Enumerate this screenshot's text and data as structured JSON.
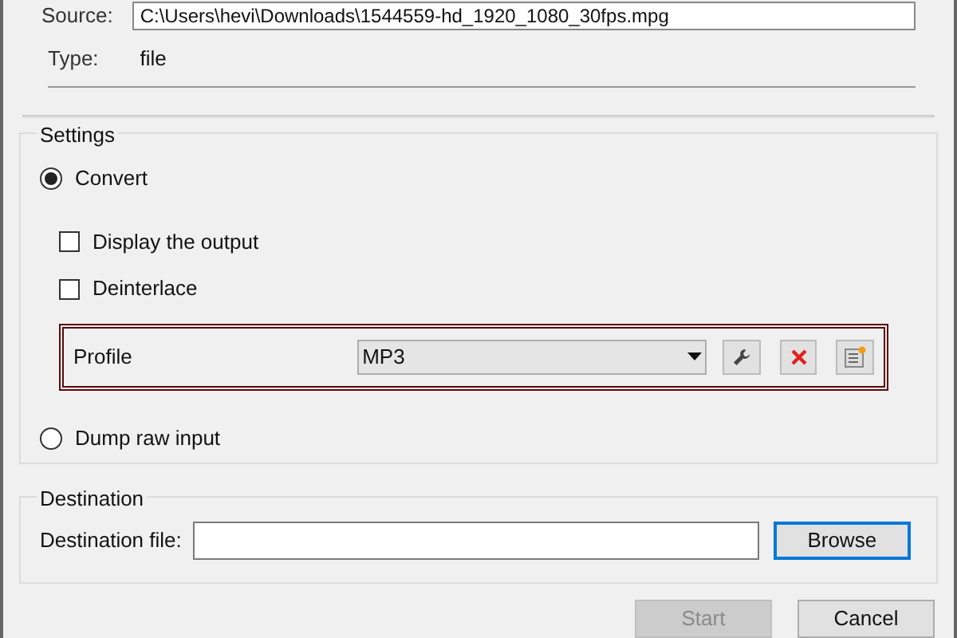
{
  "source": {
    "label": "Source:",
    "value": "C:\\Users\\hevi\\Downloads\\1544559-hd_1920_1080_30fps.mpg"
  },
  "type": {
    "label": "Type:",
    "value": "file"
  },
  "settings": {
    "title": "Settings",
    "modes": [
      {
        "label": "Convert",
        "selected": true
      },
      {
        "label": "Dump raw input",
        "selected": false
      }
    ],
    "options": [
      {
        "label": "Display the output",
        "checked": false
      },
      {
        "label": "Deinterlace",
        "checked": false
      }
    ],
    "profile": {
      "label": "Profile",
      "value": "MP3",
      "highlighted": true
    }
  },
  "destination": {
    "title": "Destination",
    "label": "Destination file:",
    "browse": "Browse"
  },
  "buttons": [
    {
      "label": "Start",
      "disabled": true
    },
    {
      "label": "Cancel",
      "disabled": false
    }
  ]
}
